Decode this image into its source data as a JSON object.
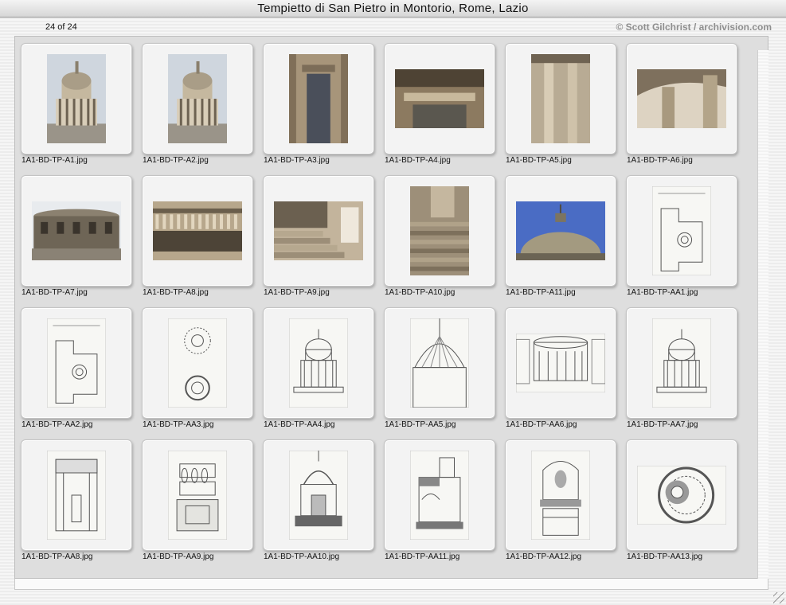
{
  "window": {
    "title": "Tempietto di San Pietro in Montorio, Rome, Lazio"
  },
  "header": {
    "count": "24 of 24",
    "credit": "© Scott Gilchrist / archivision.com"
  },
  "items": [
    {
      "file": "1A1-BD-TP-A1.jpg",
      "kind": "photo-tempietto",
      "orient": "portrait"
    },
    {
      "file": "1A1-BD-TP-A2.jpg",
      "kind": "photo-tempietto",
      "orient": "portrait"
    },
    {
      "file": "1A1-BD-TP-A3.jpg",
      "kind": "photo-door",
      "orient": "portrait"
    },
    {
      "file": "1A1-BD-TP-A4.jpg",
      "kind": "photo-lintel",
      "orient": "landscape"
    },
    {
      "file": "1A1-BD-TP-A5.jpg",
      "kind": "photo-columns",
      "orient": "portrait"
    },
    {
      "file": "1A1-BD-TP-A6.jpg",
      "kind": "photo-colonnade",
      "orient": "landscape"
    },
    {
      "file": "1A1-BD-TP-A7.jpg",
      "kind": "photo-drum",
      "orient": "landscape"
    },
    {
      "file": "1A1-BD-TP-A8.jpg",
      "kind": "photo-balustrade",
      "orient": "landscape"
    },
    {
      "file": "1A1-BD-TP-A9.jpg",
      "kind": "photo-steps",
      "orient": "landscape"
    },
    {
      "file": "1A1-BD-TP-A10.jpg",
      "kind": "photo-steps-vertical",
      "orient": "portrait"
    },
    {
      "file": "1A1-BD-TP-A11.jpg",
      "kind": "photo-dome-sky",
      "orient": "landscape"
    },
    {
      "file": "1A1-BD-TP-AA1.jpg",
      "kind": "drawing-plan",
      "orient": "portrait"
    },
    {
      "file": "1A1-BD-TP-AA2.jpg",
      "kind": "drawing-plan",
      "orient": "portrait"
    },
    {
      "file": "1A1-BD-TP-AA3.jpg",
      "kind": "drawing-circles",
      "orient": "portrait"
    },
    {
      "file": "1A1-BD-TP-AA4.jpg",
      "kind": "drawing-elevation",
      "orient": "portrait"
    },
    {
      "file": "1A1-BD-TP-AA5.jpg",
      "kind": "drawing-dome",
      "orient": "portrait"
    },
    {
      "file": "1A1-BD-TP-AA6.jpg",
      "kind": "drawing-courtyard",
      "orient": "landscape"
    },
    {
      "file": "1A1-BD-TP-AA7.jpg",
      "kind": "drawing-elevation",
      "orient": "portrait"
    },
    {
      "file": "1A1-BD-TP-AA8.jpg",
      "kind": "drawing-detail",
      "orient": "portrait"
    },
    {
      "file": "1A1-BD-TP-AA9.jpg",
      "kind": "drawing-balusters",
      "orient": "portrait"
    },
    {
      "file": "1A1-BD-TP-AA10.jpg",
      "kind": "drawing-section",
      "orient": "portrait"
    },
    {
      "file": "1A1-BD-TP-AA11.jpg",
      "kind": "drawing-half-section",
      "orient": "portrait"
    },
    {
      "file": "1A1-BD-TP-AA12.jpg",
      "kind": "drawing-niche",
      "orient": "portrait"
    },
    {
      "file": "1A1-BD-TP-AA13.jpg",
      "kind": "drawing-round-plan",
      "orient": "landscape"
    }
  ]
}
